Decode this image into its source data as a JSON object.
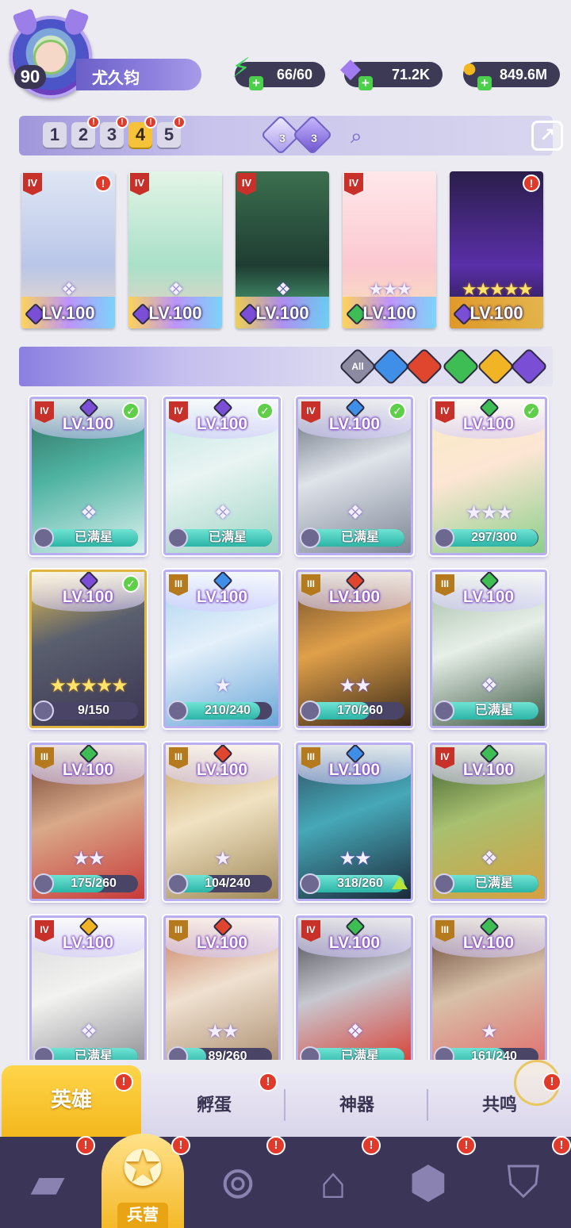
{
  "player": {
    "level": "90",
    "name": "尤久钧"
  },
  "resources": {
    "energy": "66/60",
    "gems": "71.2K",
    "gold": "849.6M"
  },
  "team_tabs": [
    "1",
    "2",
    "3",
    "4",
    "5"
  ],
  "active_team_tab": "4",
  "team_crystals": [
    "3",
    "3"
  ],
  "team_cards": [
    {
      "rank": "IV",
      "level": "LV.100",
      "stars": "",
      "element": "dark",
      "alert": "!"
    },
    {
      "rank": "IV",
      "level": "LV.100",
      "stars": "",
      "element": "dark",
      "alert": ""
    },
    {
      "rank": "IV",
      "level": "LV.100",
      "stars": "",
      "element": "dark",
      "alert": ""
    },
    {
      "rank": "IV",
      "level": "LV.100",
      "stars": "★★★",
      "element": "wind",
      "alert": ""
    },
    {
      "rank": "",
      "level": "LV.100",
      "stars": "★★★★★",
      "element": "dark",
      "alert": "!"
    }
  ],
  "filters": [
    "All",
    "water",
    "fire",
    "wind",
    "light",
    "dark"
  ],
  "heroes": [
    {
      "rank": "IV",
      "level": "LV.100",
      "element": "dark",
      "check": true,
      "stars": "",
      "progress": "已满星",
      "fill": 1.0
    },
    {
      "rank": "IV",
      "level": "LV.100",
      "element": "dark",
      "check": true,
      "stars": "",
      "progress": "已满星",
      "fill": 1.0
    },
    {
      "rank": "IV",
      "level": "LV.100",
      "element": "water",
      "check": true,
      "stars": "",
      "progress": "已满星",
      "fill": 1.0
    },
    {
      "rank": "IV",
      "level": "LV.100",
      "element": "wind",
      "check": true,
      "stars": "★★★",
      "progress": "297/300",
      "fill": 0.99
    },
    {
      "rank": "",
      "level": "LV.100",
      "element": "dark",
      "check": true,
      "stars": "★★★★★",
      "progress": "9/150",
      "fill": 0.06
    },
    {
      "rank": "III",
      "level": "LV.100",
      "element": "water",
      "check": false,
      "stars": "★",
      "progress": "210/240",
      "fill": 0.875
    },
    {
      "rank": "III",
      "level": "LV.100",
      "element": "fire",
      "check": false,
      "stars": "★★",
      "progress": "170/260",
      "fill": 0.65
    },
    {
      "rank": "III",
      "level": "LV.100",
      "element": "wind",
      "check": false,
      "stars": "",
      "progress": "已满星",
      "fill": 1.0
    },
    {
      "rank": "III",
      "level": "LV.100",
      "element": "wind",
      "check": false,
      "stars": "★★",
      "progress": "175/260",
      "fill": 0.67
    },
    {
      "rank": "III",
      "level": "LV.100",
      "element": "fire",
      "check": false,
      "stars": "★",
      "progress": "104/240",
      "fill": 0.43
    },
    {
      "rank": "III",
      "level": "LV.100",
      "element": "water",
      "check": false,
      "stars": "★★",
      "progress": "318/260",
      "fill": 1.0,
      "up": true
    },
    {
      "rank": "IV",
      "level": "LV.100",
      "element": "wind",
      "check": false,
      "stars": "",
      "progress": "已满星",
      "fill": 1.0
    },
    {
      "rank": "IV",
      "level": "LV.100",
      "element": "light",
      "check": false,
      "stars": "",
      "progress": "已满星",
      "fill": 1.0
    },
    {
      "rank": "III",
      "level": "LV.100",
      "element": "fire",
      "check": false,
      "stars": "★★",
      "progress": "89/260",
      "fill": 0.34
    },
    {
      "rank": "IV",
      "level": "LV.100",
      "element": "wind",
      "check": false,
      "stars": "",
      "progress": "已满星",
      "fill": 1.0
    },
    {
      "rank": "III",
      "level": "LV.100",
      "element": "wind",
      "check": false,
      "stars": "★",
      "progress": "161/240",
      "fill": 0.67
    }
  ],
  "sub_tabs": [
    "英雄",
    "孵蛋",
    "神器",
    "共鸣"
  ],
  "bottom_nav": {
    "active_label": "兵营"
  },
  "colors": {
    "dark": "#7a4fd6",
    "water": "#3f8fe8",
    "fire": "#e0462e",
    "wind": "#3ebd54",
    "light": "#f1b424",
    "accent": "#f5c23a"
  }
}
